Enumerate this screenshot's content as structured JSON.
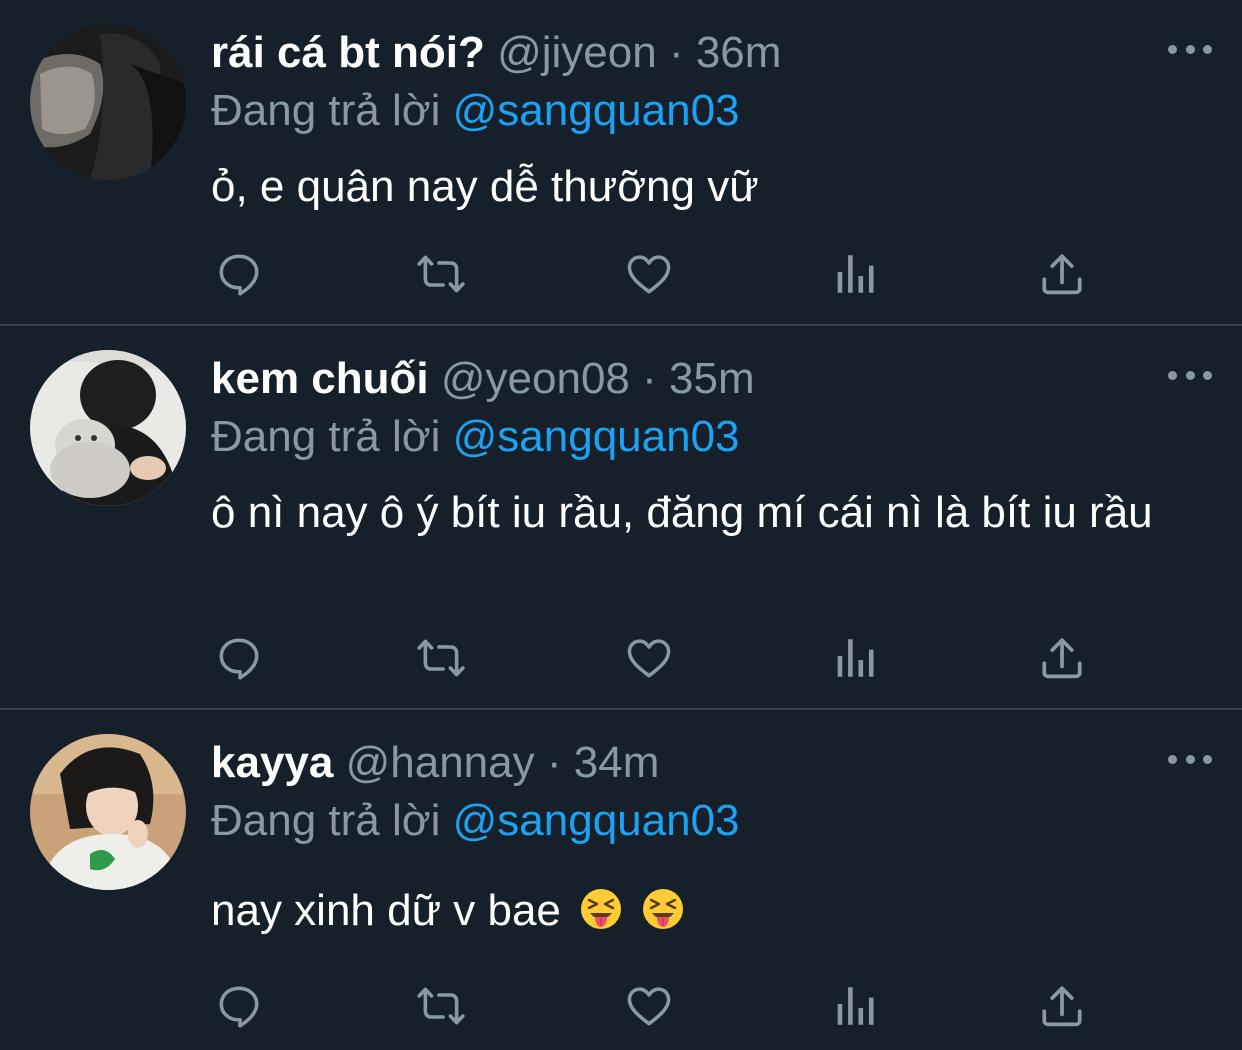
{
  "tweets": [
    {
      "name": "rái cá bt nói?",
      "handle": "@jiyeon",
      "dot": "·",
      "time": "36m",
      "reply_prefix": "Đang trả lời",
      "reply_to": "@sangquan03",
      "text": "ỏ, e quân nay dễ thưỡng vữ"
    },
    {
      "name": "kem chuối",
      "handle": "@yeon08",
      "dot": "·",
      "time": "35m",
      "reply_prefix": "Đang trả lời",
      "reply_to": "@sangquan03",
      "text": "ô nì nay ô ý bít iu rầu, đăng mí cái nì là bít iu rầu"
    },
    {
      "name": "kayya",
      "handle": "@hannay",
      "dot": "·",
      "time": "34m",
      "reply_prefix": "Đang trả lời",
      "reply_to": "@sangquan03",
      "text": "nay xinh dữ v bae",
      "emojis": [
        "squinting-face-with-tongue",
        "squinting-face-with-tongue"
      ]
    }
  ],
  "colors": {
    "background": "#15202b",
    "divider": "#38444d",
    "secondary_text": "#8899a6",
    "mention": "#1da1f2"
  },
  "icons": [
    "reply-icon",
    "retweet-icon",
    "like-icon",
    "analytics-icon",
    "share-icon",
    "more-icon"
  ]
}
